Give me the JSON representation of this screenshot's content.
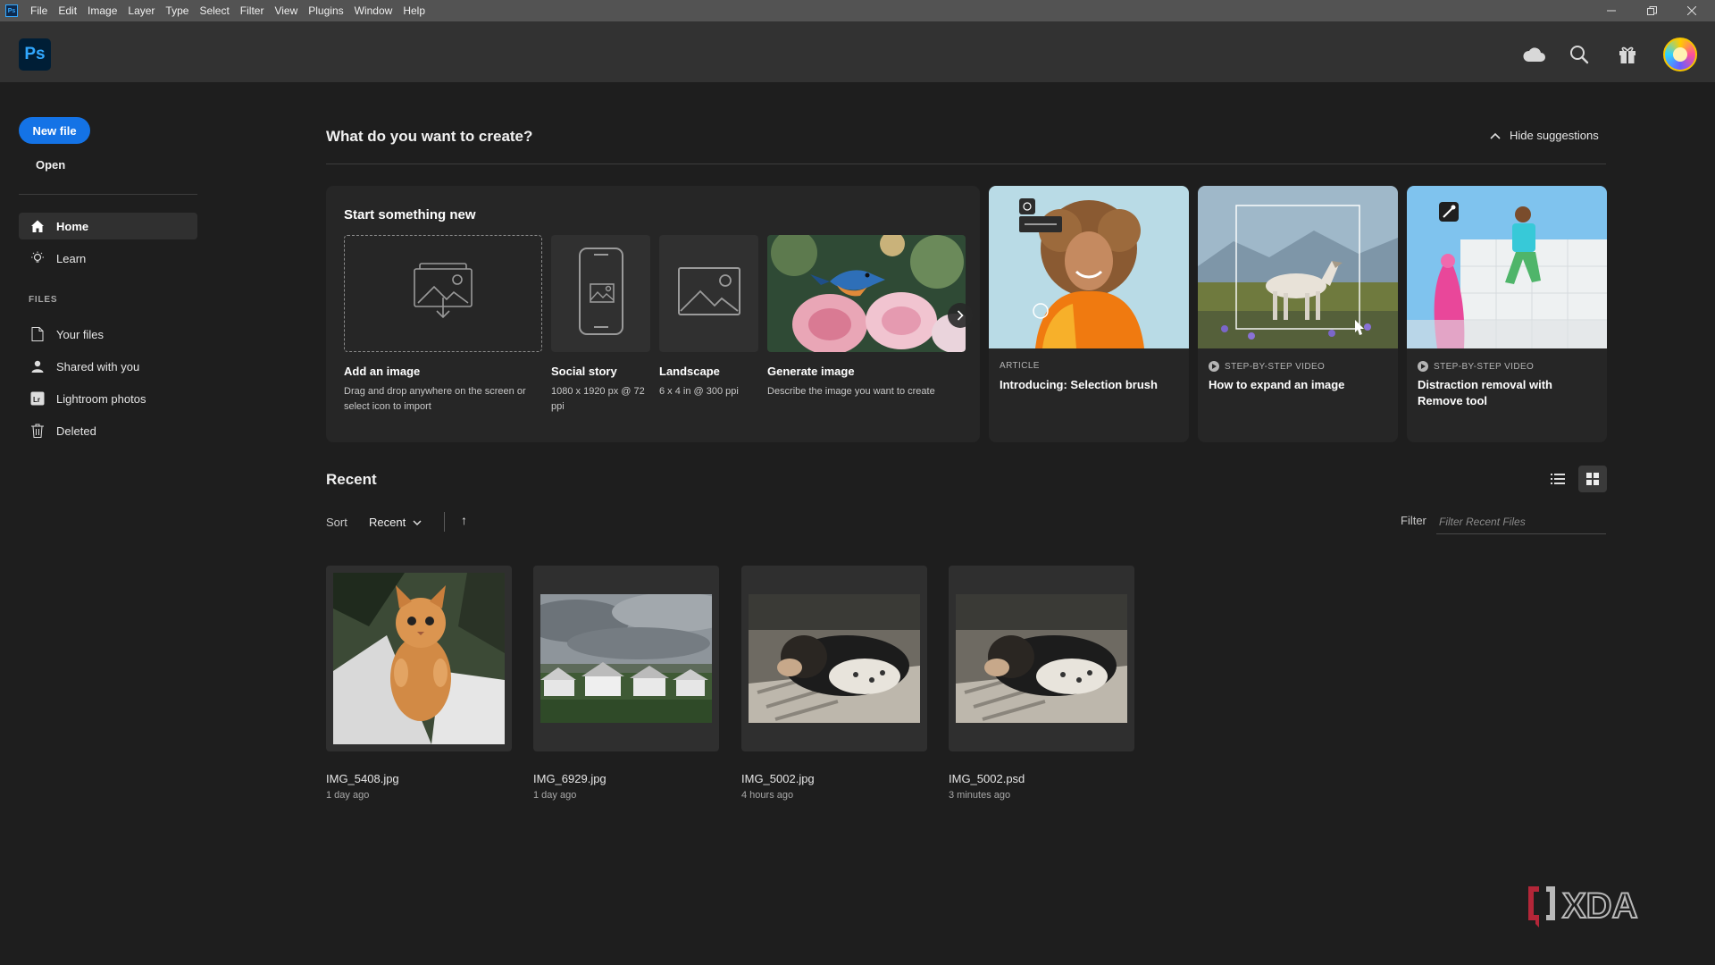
{
  "menubar": {
    "app_icon": "Ps",
    "items": [
      "File",
      "Edit",
      "Image",
      "Layer",
      "Type",
      "Select",
      "Filter",
      "View",
      "Plugins",
      "Window",
      "Help"
    ],
    "window_controls": [
      "minimize-icon",
      "restore-icon",
      "close-icon"
    ]
  },
  "header": {
    "logo": "Ps",
    "icons": [
      "cloud-icon",
      "search-icon",
      "gift-icon",
      "avatar"
    ]
  },
  "sidebar": {
    "new_file_label": "New file",
    "open_label": "Open",
    "nav": [
      {
        "label": "Home",
        "icon": "home-icon",
        "active": true
      },
      {
        "label": "Learn",
        "icon": "lightbulb-icon",
        "active": false
      }
    ],
    "files_heading": "FILES",
    "files": [
      {
        "label": "Your files",
        "icon": "file-icon"
      },
      {
        "label": "Shared with you",
        "icon": "shared-user-icon"
      },
      {
        "label": "Lightroom photos",
        "icon": "lightroom-icon"
      },
      {
        "label": "Deleted",
        "icon": "trash-icon"
      }
    ]
  },
  "main": {
    "question": "What do you want to create?",
    "hide_suggestions_label": "Hide suggestions",
    "start_title": "Start something new",
    "tiles": [
      {
        "title": "Add an image",
        "desc": "Drag and drop anywhere on the screen or select icon to import"
      },
      {
        "title": "Social story",
        "desc": "1080 x 1920 px @ 72 ppi"
      },
      {
        "title": "Landscape",
        "desc": "6 x 4 in @ 300 ppi"
      },
      {
        "title": "Generate image",
        "desc": "Describe the image you want to create"
      }
    ],
    "suggestions": [
      {
        "kicker": "ARTICLE",
        "title": "Introducing: Selection brush"
      },
      {
        "kicker": "STEP-BY-STEP VIDEO",
        "title": "How to expand an image"
      },
      {
        "kicker": "STEP-BY-STEP VIDEO",
        "title": "Distraction removal with Remove tool"
      }
    ]
  },
  "recent": {
    "title": "Recent",
    "sort_label": "Sort",
    "sort_value": "Recent",
    "sort_direction": "↑",
    "filter_label": "Filter",
    "filter_placeholder": "Filter Recent Files",
    "view_modes": [
      "list-view-icon",
      "grid-view-icon"
    ],
    "active_view": "grid",
    "files": [
      {
        "name": "IMG_5408.jpg",
        "time": "1 day ago"
      },
      {
        "name": "IMG_6929.jpg",
        "time": "1 day ago"
      },
      {
        "name": "IMG_5002.jpg",
        "time": "4 hours ago"
      },
      {
        "name": "IMG_5002.psd",
        "time": "3 minutes ago"
      }
    ]
  },
  "watermark": "XDA",
  "colors": {
    "accent": "#1473e6",
    "background": "#1e1e1e",
    "panel": "#262626",
    "appbar": "#323232",
    "menubar": "#535353"
  }
}
